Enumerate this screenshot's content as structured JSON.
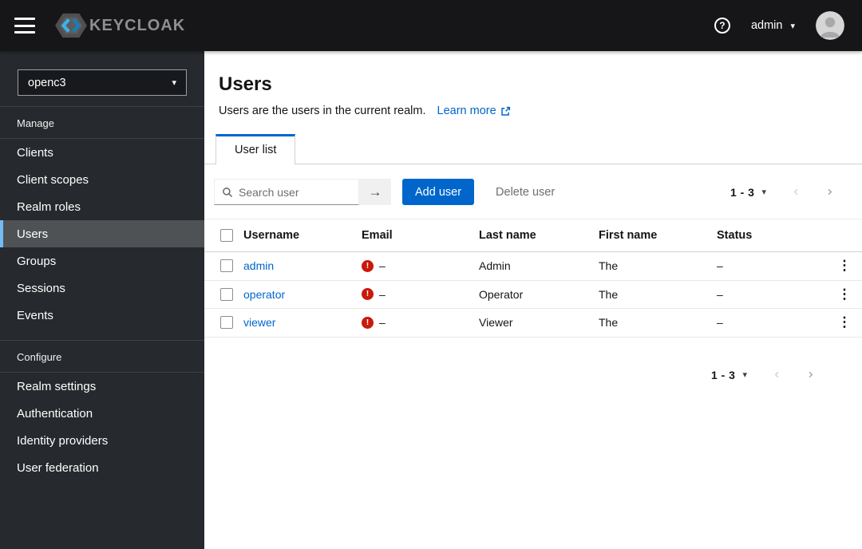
{
  "colors": {
    "primary": "#0066cc",
    "link": "#0066cc",
    "danger": "#c9190b",
    "nav_active_border": "#73bcf7",
    "masthead_bg": "#161618",
    "sidebar_bg": "#26292d"
  },
  "icons": {
    "kebab": "⋮",
    "caret": "▾",
    "search_arrow": "→",
    "help": "?"
  },
  "header": {
    "brand": "KEYCLOAK",
    "user_label": "admin"
  },
  "sidebar": {
    "realm_selector": {
      "value": "openc3"
    },
    "active_item": "Users",
    "sections": [
      {
        "label": "Manage",
        "items": [
          "Clients",
          "Client scopes",
          "Realm roles",
          "Users",
          "Groups",
          "Sessions",
          "Events"
        ]
      },
      {
        "label": "Configure",
        "items": [
          "Realm settings",
          "Authentication",
          "Identity providers",
          "User federation"
        ]
      }
    ]
  },
  "main": {
    "title": "Users",
    "description": "Users are the users in the current realm.",
    "learn_more_label": "Learn more",
    "tabs": [
      {
        "label": "User list"
      }
    ],
    "toolbar": {
      "search_placeholder": "Search user",
      "add_user_label": "Add user",
      "delete_user_label": "Delete user",
      "pagination_range": "1 - 3"
    },
    "table": {
      "columns": [
        "Username",
        "Email",
        "Last name",
        "First name",
        "Status"
      ],
      "rows": [
        {
          "username": "admin",
          "email": "–",
          "last_name": "Admin",
          "first_name": "The",
          "status": "–"
        },
        {
          "username": "operator",
          "email": "–",
          "last_name": "Operator",
          "first_name": "The",
          "status": "–"
        },
        {
          "username": "viewer",
          "email": "–",
          "last_name": "Viewer",
          "first_name": "The",
          "status": "–"
        }
      ]
    },
    "bottom_pagination_range": "1 - 3"
  }
}
